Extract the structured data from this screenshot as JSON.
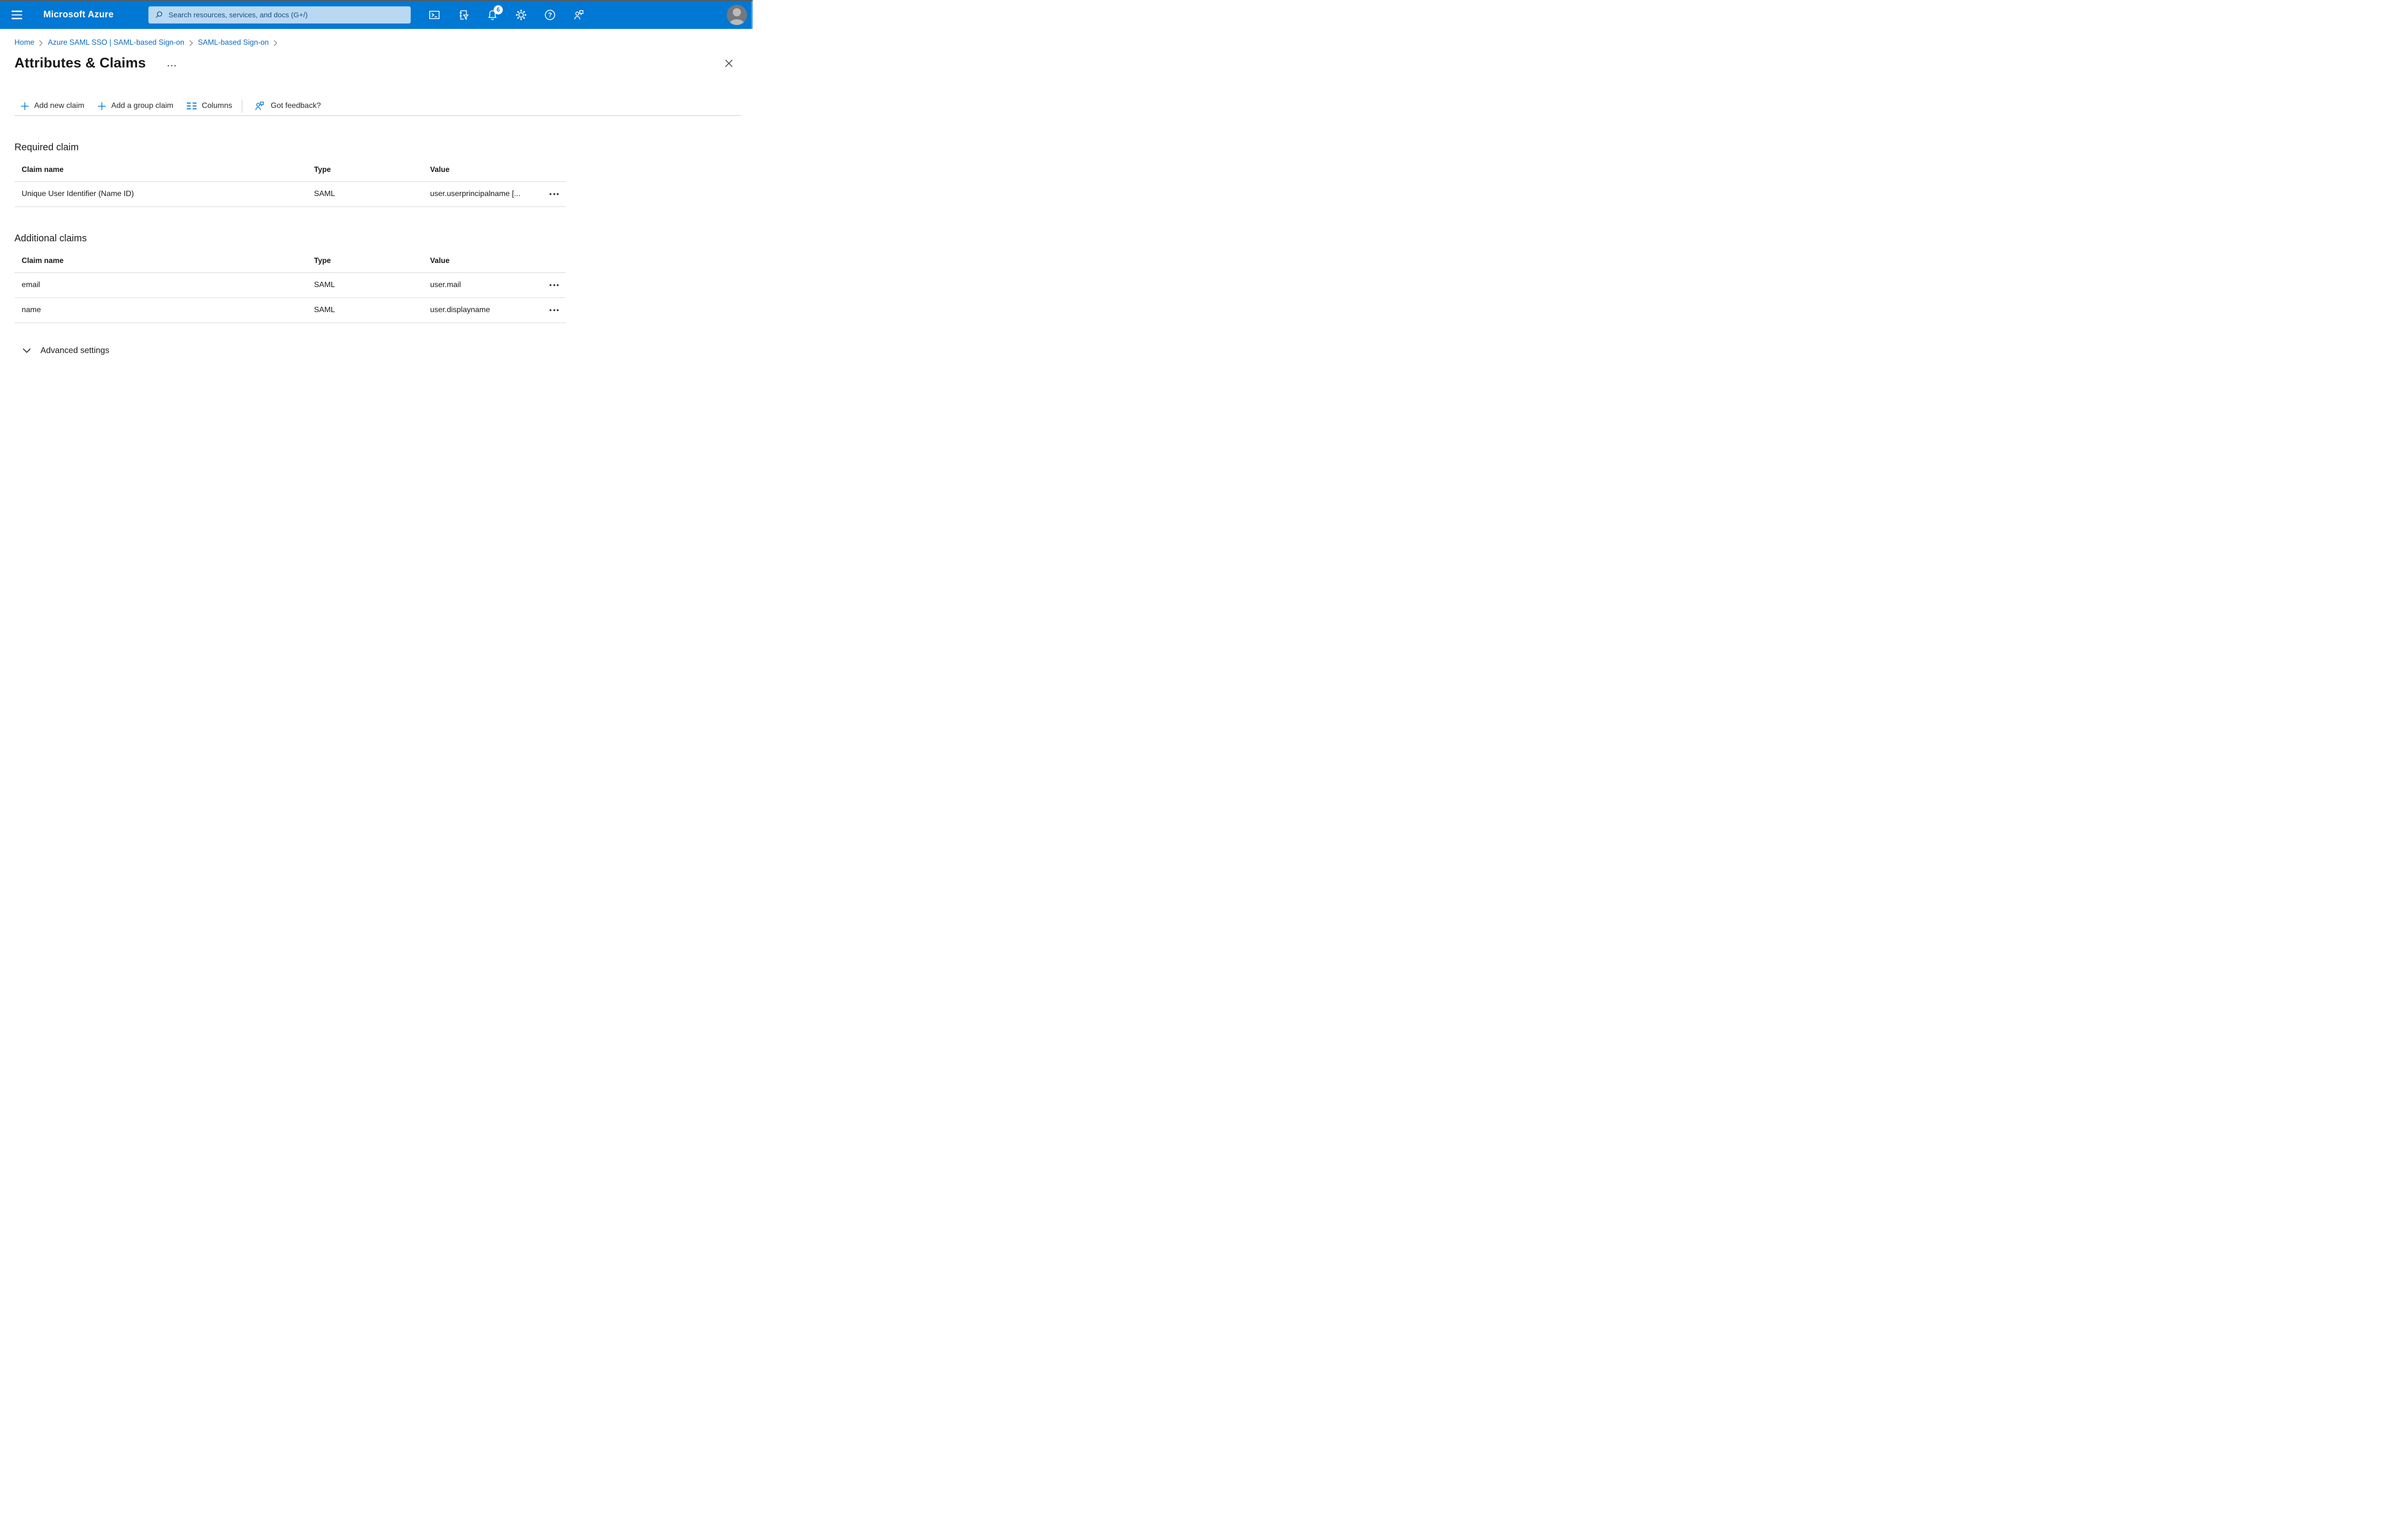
{
  "colors": {
    "topbar_blue": "#0078d4",
    "search_box_blue": "#b9d9f2",
    "search_text_blue": "#1a4e7f",
    "link_blue": "#0f6cbd",
    "icon_blue": "#0078d4",
    "text_dark": "#1b1b1b",
    "divider_gray": "#e1e1e1",
    "badge_bg": "#ffffff",
    "badge_text": "#0078d4"
  },
  "topbar": {
    "brand": "Microsoft Azure",
    "search_placeholder": "Search resources, services, and docs (G+/)",
    "notification_count": "6",
    "icons": [
      "hamburger-icon",
      "search-icon",
      "cloud-shell-icon",
      "directory-filter-icon",
      "notifications-bell-icon",
      "settings-gear-icon",
      "help-icon",
      "feedback-icon",
      "avatar"
    ]
  },
  "breadcrumb": {
    "items": [
      {
        "label": "Home"
      },
      {
        "label": "Azure SAML SSO | SAML-based Sign-on"
      },
      {
        "label": "SAML-based Sign-on"
      }
    ]
  },
  "page": {
    "title": "Attributes & Claims"
  },
  "toolbar": {
    "items": [
      {
        "label": "Add new claim"
      },
      {
        "label": "Add a group claim"
      },
      {
        "label": "Columns"
      },
      {
        "label": "Got feedback?"
      }
    ]
  },
  "sections": {
    "required": {
      "heading": "Required claim",
      "columns": [
        "Claim name",
        "Type",
        "Value"
      ],
      "rows": [
        {
          "claim_name": "Unique User Identifier (Name ID)",
          "type": "SAML",
          "value": "user.userprincipalname [..."
        }
      ]
    },
    "additional": {
      "heading": "Additional claims",
      "columns": [
        "Claim name",
        "Type",
        "Value"
      ],
      "rows": [
        {
          "claim_name": "email",
          "type": "SAML",
          "value": "user.mail"
        },
        {
          "claim_name": "name",
          "type": "SAML",
          "value": "user.displayname"
        }
      ]
    }
  },
  "advanced": {
    "label": "Advanced settings"
  }
}
